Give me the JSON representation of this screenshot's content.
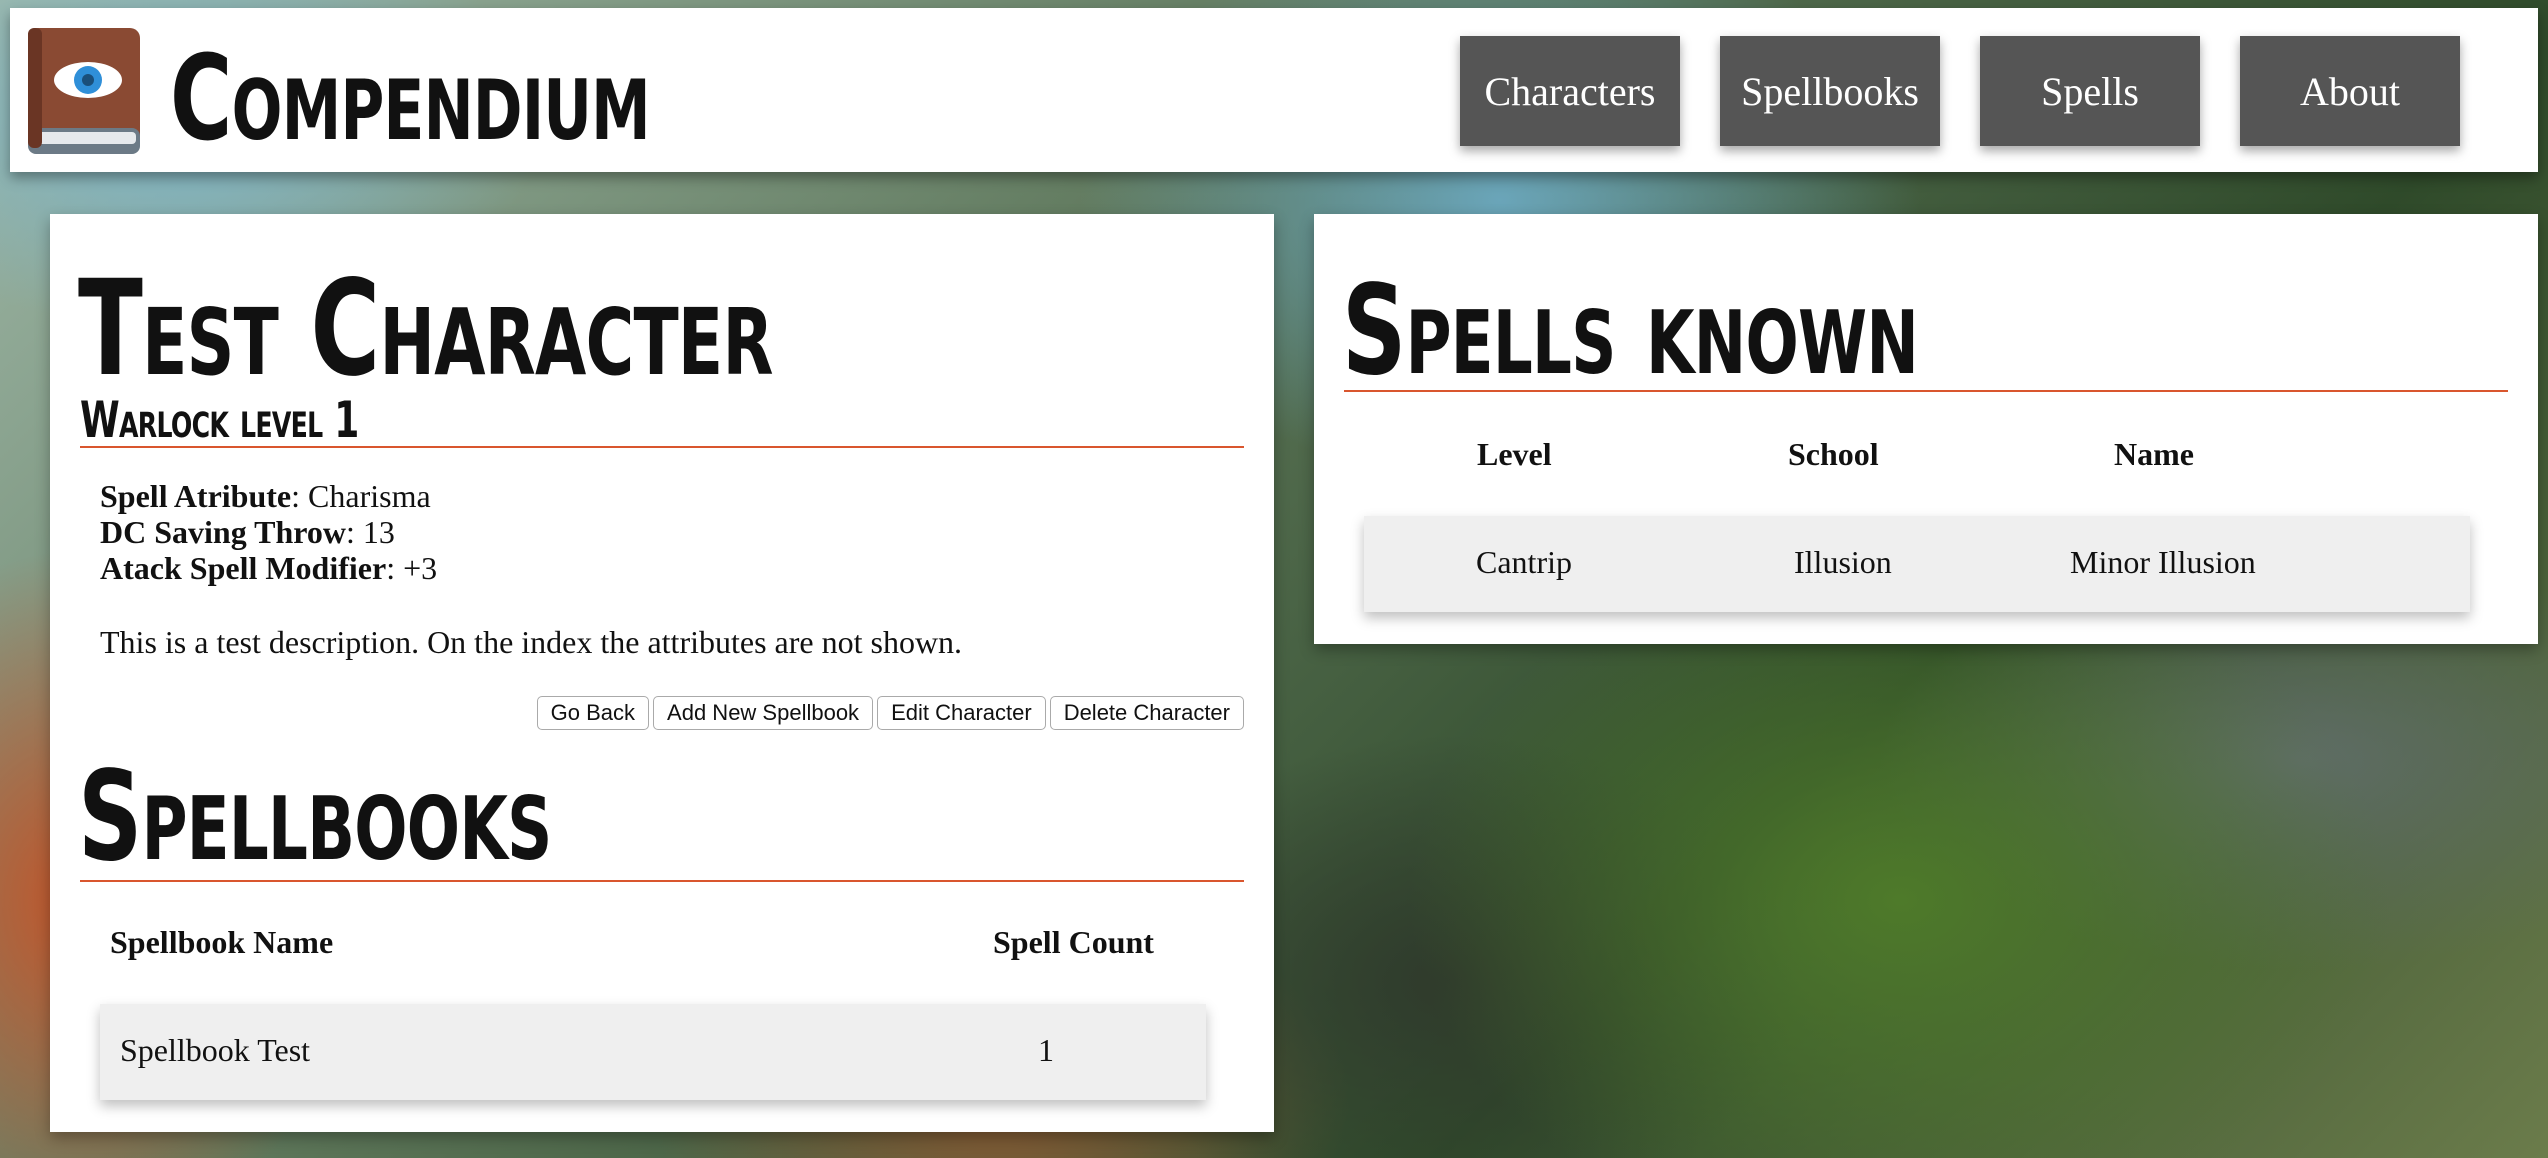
{
  "header": {
    "brand": "Compendium",
    "nav": [
      "Characters",
      "Spellbooks",
      "Spells",
      "About"
    ]
  },
  "character": {
    "name": "Test Character",
    "class_level": "Warlock level 1",
    "attributes": [
      {
        "label": "Spell Atribute",
        "value": ": Charisma"
      },
      {
        "label": "DC Saving Throw",
        "value": ": 13"
      },
      {
        "label": "Atack Spell Modifier",
        "value": ": +3"
      }
    ],
    "description": "This is a test description. On the index the attributes are not shown.",
    "buttons": [
      "Go Back",
      "Add New Spellbook",
      "Edit Character",
      "Delete Character"
    ]
  },
  "spellbooks": {
    "title": "Spellbooks",
    "columns": [
      "Spellbook Name",
      "Spell Count"
    ],
    "rows": [
      {
        "name": "Spellbook Test",
        "count": "1"
      }
    ]
  },
  "spells_known": {
    "title": "Spells known",
    "columns": [
      "Level",
      "School",
      "Name"
    ],
    "rows": [
      {
        "level": "Cantrip",
        "school": "Illusion",
        "name": "Minor Illusion"
      }
    ]
  },
  "colors": {
    "accent_rule": "#d9562e",
    "nav_button": "#555555",
    "row_bg": "#efefef"
  }
}
